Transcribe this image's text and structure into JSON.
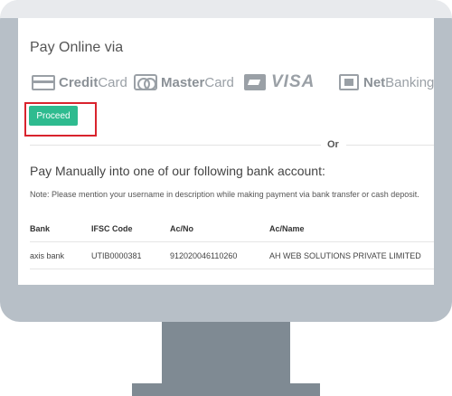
{
  "pay_online": {
    "title": "Pay Online via",
    "methods": {
      "credit_card": {
        "strong": "Credit",
        "light": "Card"
      },
      "master_card": {
        "strong": "Master",
        "light": "Card"
      },
      "visa": {
        "label": "VISA"
      },
      "net_banking": {
        "strong": "Net",
        "light": "Banking"
      }
    },
    "proceed_label": "Proceed"
  },
  "divider": {
    "label": "Or"
  },
  "manual": {
    "title": "Pay Manually into one of our following bank account:",
    "note": "Note: Please mention your username in description while making payment via bank transfer or cash deposit."
  },
  "bank_table": {
    "headers": {
      "bank": "Bank",
      "ifsc": "IFSC Code",
      "acno": "Ac/No",
      "acname": "Ac/Name"
    },
    "rows": [
      {
        "bank": "axis bank",
        "ifsc": "UTIB0000381",
        "acno": "912020046110260",
        "acname": "AH WEB SOLUTIONS PRIVATE LIMITED"
      }
    ]
  },
  "colors": {
    "accent": "#2ebb8f",
    "highlight": "#d9232d",
    "monitor": "#b7bfc7",
    "stand": "#7f8a93"
  }
}
